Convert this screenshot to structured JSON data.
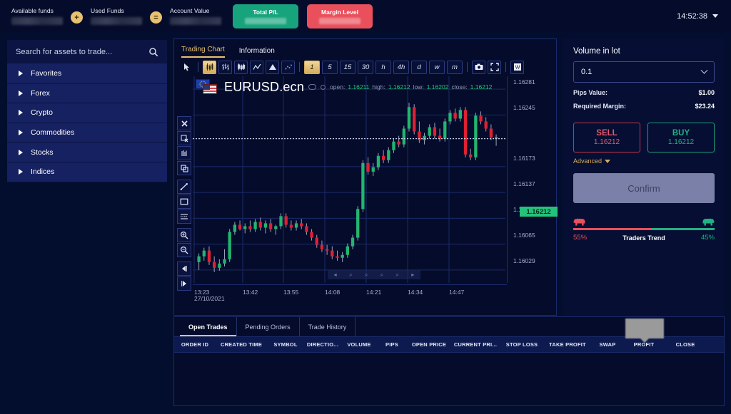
{
  "header": {
    "funds": [
      {
        "label": "Available funds",
        "value": ""
      },
      {
        "label": "Used Funds",
        "value": ""
      },
      {
        "label": "Account Value",
        "value": ""
      }
    ],
    "op_plus": "+",
    "op_equals": "=",
    "total_pl_label": "Total P/L",
    "margin_level_label": "Margin Level",
    "time": "14:52:38",
    "colors": {
      "green": "#17a47c",
      "red": "#e9505c",
      "gold": "#e8c170"
    }
  },
  "sidebar": {
    "search_placeholder": "Search for assets to trade...",
    "search_value": "",
    "categories": [
      {
        "label": "Favorites"
      },
      {
        "label": "Forex"
      },
      {
        "label": "Crypto"
      },
      {
        "label": "Commodities"
      },
      {
        "label": "Stocks"
      },
      {
        "label": "Indices"
      }
    ]
  },
  "chart": {
    "tabs": [
      {
        "label": "Trading Chart",
        "active": true
      },
      {
        "label": "Information",
        "active": false
      }
    ],
    "tools": [
      {
        "name": "cursor-icon",
        "glyph": "➤"
      },
      {
        "name": "candlestick-chart-icon",
        "glyph": "☰"
      },
      {
        "name": "bar-chart-icon",
        "glyph": "‖"
      },
      {
        "name": "hollow-candle-icon",
        "glyph": "║"
      },
      {
        "name": "line-chart-icon",
        "glyph": "∧"
      },
      {
        "name": "area-chart-icon",
        "glyph": "▲"
      },
      {
        "name": "dot-chart-icon",
        "glyph": "∴"
      }
    ],
    "timeframes": [
      {
        "label": "1",
        "active": true
      },
      {
        "label": "5",
        "active": false
      },
      {
        "label": "15",
        "active": false
      },
      {
        "label": "30",
        "active": false
      },
      {
        "label": "h",
        "active": false
      },
      {
        "label": "4h",
        "active": false
      },
      {
        "label": "d",
        "active": false
      },
      {
        "label": "w",
        "active": false
      },
      {
        "label": "m",
        "active": false
      }
    ],
    "right_tools": [
      {
        "name": "camera-icon",
        "glyph": "📷"
      },
      {
        "name": "fullscreen-icon",
        "glyph": "⛶"
      },
      {
        "name": "watermark-icon",
        "glyph": "W"
      }
    ],
    "vertical_tools": [
      {
        "name": "close-icon",
        "glyph": "✖"
      },
      {
        "name": "remove-drawing-icon",
        "glyph": "⌧"
      },
      {
        "name": "magnet-icon",
        "glyph": "║"
      },
      {
        "name": "copy-icon",
        "glyph": "❐"
      },
      {
        "name": "trend-line-icon",
        "glyph": "╱"
      },
      {
        "name": "rectangle-icon",
        "glyph": "▭"
      },
      {
        "name": "horizontal-lines-icon",
        "glyph": "≡"
      },
      {
        "name": "zoom-in-icon",
        "glyph": "⌕"
      },
      {
        "name": "zoom-out-icon",
        "glyph": "⌕"
      },
      {
        "name": "scroll-left-icon",
        "glyph": "◀"
      },
      {
        "name": "scroll-right-icon",
        "glyph": "▶"
      }
    ],
    "nav_controls": [
      {
        "name": "nav-left-icon",
        "glyph": "◂"
      },
      {
        "name": "nav-zoom-in-icon",
        "glyph": "⌕"
      },
      {
        "name": "nav-zoom-out-icon",
        "glyph": "⌕"
      },
      {
        "name": "nav-reset-icon",
        "glyph": "⌕"
      },
      {
        "name": "nav-fit-icon",
        "glyph": "⌕"
      },
      {
        "name": "nav-right-icon",
        "glyph": "▸"
      }
    ],
    "symbol": "EURUSD.ecn",
    "ohlc": {
      "open_label": "open:",
      "open": "1.16211",
      "high_label": "high:",
      "high": "1.16212",
      "low_label": "low:",
      "low": "1.16202",
      "close_label": "close:",
      "close": "1.16212"
    },
    "current_price": "1.16212"
  },
  "chart_data": {
    "type": "line",
    "title": "EURUSD.ecn",
    "xlabel": "",
    "ylabel": "",
    "date": "27/10/2021",
    "grid": true,
    "legend_position": "none",
    "y_ticks": [
      "1.16281",
      "1.16245",
      "1.16212",
      "1.16173",
      "1.16137",
      "1.16101",
      "1.16065",
      "1.16029"
    ],
    "ylim": [
      1.16011,
      1.16299
    ],
    "x_ticks": [
      "13:23",
      "13:42",
      "13:55",
      "14:08",
      "14:21",
      "14:34",
      "14:47"
    ],
    "current_price_line": 1.16212,
    "candles": [
      {
        "o": 1.1604,
        "h": 1.16052,
        "l": 1.16029,
        "c": 1.16048,
        "dir": "up"
      },
      {
        "o": 1.16048,
        "h": 1.1606,
        "l": 1.16042,
        "c": 1.16056,
        "dir": "up"
      },
      {
        "o": 1.16056,
        "h": 1.16062,
        "l": 1.16036,
        "c": 1.1604,
        "dir": "down"
      },
      {
        "o": 1.1604,
        "h": 1.16048,
        "l": 1.16026,
        "c": 1.16032,
        "dir": "down"
      },
      {
        "o": 1.16032,
        "h": 1.16044,
        "l": 1.16028,
        "c": 1.16038,
        "dir": "up"
      },
      {
        "o": 1.16038,
        "h": 1.16058,
        "l": 1.16034,
        "c": 1.16044,
        "dir": "up"
      },
      {
        "o": 1.16044,
        "h": 1.16086,
        "l": 1.1604,
        "c": 1.16082,
        "dir": "up"
      },
      {
        "o": 1.16082,
        "h": 1.16096,
        "l": 1.16078,
        "c": 1.16092,
        "dir": "up"
      },
      {
        "o": 1.16092,
        "h": 1.16098,
        "l": 1.16084,
        "c": 1.16086,
        "dir": "down"
      },
      {
        "o": 1.16086,
        "h": 1.16094,
        "l": 1.1608,
        "c": 1.1609,
        "dir": "up"
      },
      {
        "o": 1.1609,
        "h": 1.16098,
        "l": 1.16082,
        "c": 1.16086,
        "dir": "down"
      },
      {
        "o": 1.16086,
        "h": 1.161,
        "l": 1.16082,
        "c": 1.16096,
        "dir": "up"
      },
      {
        "o": 1.16096,
        "h": 1.16102,
        "l": 1.16084,
        "c": 1.16088,
        "dir": "down"
      },
      {
        "o": 1.16088,
        "h": 1.16098,
        "l": 1.1608,
        "c": 1.16094,
        "dir": "up"
      },
      {
        "o": 1.16094,
        "h": 1.161,
        "l": 1.16082,
        "c": 1.16086,
        "dir": "down"
      },
      {
        "o": 1.16086,
        "h": 1.16092,
        "l": 1.16078,
        "c": 1.1609,
        "dir": "up"
      },
      {
        "o": 1.1609,
        "h": 1.16108,
        "l": 1.16086,
        "c": 1.16104,
        "dir": "up"
      },
      {
        "o": 1.16104,
        "h": 1.16108,
        "l": 1.16088,
        "c": 1.16092,
        "dir": "down"
      },
      {
        "o": 1.16092,
        "h": 1.16098,
        "l": 1.16084,
        "c": 1.16088,
        "dir": "down"
      },
      {
        "o": 1.16088,
        "h": 1.16098,
        "l": 1.16084,
        "c": 1.16094,
        "dir": "up"
      },
      {
        "o": 1.16094,
        "h": 1.161,
        "l": 1.16086,
        "c": 1.1609,
        "dir": "down"
      },
      {
        "o": 1.1609,
        "h": 1.16094,
        "l": 1.16078,
        "c": 1.16082,
        "dir": "down"
      },
      {
        "o": 1.16082,
        "h": 1.16086,
        "l": 1.1607,
        "c": 1.16074,
        "dir": "down"
      },
      {
        "o": 1.16074,
        "h": 1.16078,
        "l": 1.1606,
        "c": 1.16064,
        "dir": "down"
      },
      {
        "o": 1.16064,
        "h": 1.1607,
        "l": 1.16054,
        "c": 1.16058,
        "dir": "down"
      },
      {
        "o": 1.16058,
        "h": 1.16064,
        "l": 1.1605,
        "c": 1.16056,
        "dir": "down"
      },
      {
        "o": 1.16056,
        "h": 1.16062,
        "l": 1.16044,
        "c": 1.16048,
        "dir": "down"
      },
      {
        "o": 1.16048,
        "h": 1.16056,
        "l": 1.16042,
        "c": 1.16046,
        "dir": "down"
      },
      {
        "o": 1.16046,
        "h": 1.16054,
        "l": 1.1604,
        "c": 1.1605,
        "dir": "up"
      },
      {
        "o": 1.1605,
        "h": 1.16066,
        "l": 1.16046,
        "c": 1.16062,
        "dir": "up"
      },
      {
        "o": 1.16062,
        "h": 1.16078,
        "l": 1.16058,
        "c": 1.16074,
        "dir": "up"
      },
      {
        "o": 1.16074,
        "h": 1.16118,
        "l": 1.1607,
        "c": 1.16114,
        "dir": "up"
      },
      {
        "o": 1.16114,
        "h": 1.16182,
        "l": 1.1611,
        "c": 1.16178,
        "dir": "up"
      },
      {
        "o": 1.16178,
        "h": 1.16186,
        "l": 1.16162,
        "c": 1.16166,
        "dir": "down"
      },
      {
        "o": 1.16166,
        "h": 1.16178,
        "l": 1.1616,
        "c": 1.16172,
        "dir": "up"
      },
      {
        "o": 1.16172,
        "h": 1.16192,
        "l": 1.16168,
        "c": 1.16188,
        "dir": "up"
      },
      {
        "o": 1.16188,
        "h": 1.16196,
        "l": 1.16178,
        "c": 1.16182,
        "dir": "down"
      },
      {
        "o": 1.16182,
        "h": 1.162,
        "l": 1.16178,
        "c": 1.16196,
        "dir": "up"
      },
      {
        "o": 1.16196,
        "h": 1.16212,
        "l": 1.16192,
        "c": 1.16208,
        "dir": "up"
      },
      {
        "o": 1.16208,
        "h": 1.16216,
        "l": 1.162,
        "c": 1.16204,
        "dir": "down"
      },
      {
        "o": 1.16204,
        "h": 1.1623,
        "l": 1.162,
        "c": 1.16226,
        "dir": "up"
      },
      {
        "o": 1.16226,
        "h": 1.16262,
        "l": 1.16222,
        "c": 1.16256,
        "dir": "up"
      },
      {
        "o": 1.16256,
        "h": 1.1626,
        "l": 1.16218,
        "c": 1.16222,
        "dir": "down"
      },
      {
        "o": 1.16222,
        "h": 1.16236,
        "l": 1.16206,
        "c": 1.1621,
        "dir": "down"
      },
      {
        "o": 1.1621,
        "h": 1.1622,
        "l": 1.16204,
        "c": 1.16216,
        "dir": "up"
      },
      {
        "o": 1.16216,
        "h": 1.16232,
        "l": 1.16212,
        "c": 1.16228,
        "dir": "up"
      },
      {
        "o": 1.16228,
        "h": 1.16234,
        "l": 1.16212,
        "c": 1.16216,
        "dir": "down"
      },
      {
        "o": 1.16216,
        "h": 1.16226,
        "l": 1.16208,
        "c": 1.16212,
        "dir": "down"
      },
      {
        "o": 1.16212,
        "h": 1.1624,
        "l": 1.16208,
        "c": 1.16236,
        "dir": "up"
      },
      {
        "o": 1.16236,
        "h": 1.16252,
        "l": 1.16232,
        "c": 1.16248,
        "dir": "up"
      },
      {
        "o": 1.16248,
        "h": 1.16254,
        "l": 1.16236,
        "c": 1.1624,
        "dir": "down"
      },
      {
        "o": 1.1624,
        "h": 1.16256,
        "l": 1.16236,
        "c": 1.16252,
        "dir": "up"
      },
      {
        "o": 1.16252,
        "h": 1.16256,
        "l": 1.16186,
        "c": 1.1619,
        "dir": "down"
      },
      {
        "o": 1.1619,
        "h": 1.16198,
        "l": 1.16182,
        "c": 1.16186,
        "dir": "down"
      },
      {
        "o": 1.16186,
        "h": 1.16248,
        "l": 1.16182,
        "c": 1.16244,
        "dir": "up"
      },
      {
        "o": 1.16244,
        "h": 1.1625,
        "l": 1.16232,
        "c": 1.16236,
        "dir": "down"
      },
      {
        "o": 1.16236,
        "h": 1.16242,
        "l": 1.16222,
        "c": 1.16226,
        "dir": "down"
      },
      {
        "o": 1.16226,
        "h": 1.16232,
        "l": 1.1621,
        "c": 1.16214,
        "dir": "down"
      },
      {
        "o": 1.16214,
        "h": 1.16218,
        "l": 1.16202,
        "c": 1.16212,
        "dir": "up"
      }
    ]
  },
  "trade": {
    "volume_label": "Volume in lot",
    "volume_value": "0.1",
    "pips_value_label": "Pips Value:",
    "pips_value": "$1.00",
    "required_margin_label": "Required Margin:",
    "required_margin": "$23.24",
    "sell_label": "SELL",
    "sell_price": "1.16212",
    "buy_label": "BUY",
    "buy_price": "1.16212",
    "advanced_label": "Advanced",
    "confirm_label": "Confirm",
    "trend_label": "Traders Trend",
    "trend_sell_pct": "55%",
    "trend_buy_pct": "45%",
    "trend_sell_num": 55,
    "trend_buy_num": 45
  },
  "bottom": {
    "tabs": [
      {
        "label": "Open Trades",
        "active": true
      },
      {
        "label": "Pending Orders",
        "active": false
      },
      {
        "label": "Trade History",
        "active": false
      }
    ],
    "columns": [
      "ORDER ID",
      "CREATED TIME",
      "SYMBOL",
      "DIRECTIO...",
      "VOLUME",
      "PIPS",
      "OPEN PRICE",
      "CURRENT PRI...",
      "STOP LOSS",
      "TAKE PROFIT",
      "SWAP",
      "PROFIT",
      "CLOSE"
    ],
    "rows": []
  }
}
